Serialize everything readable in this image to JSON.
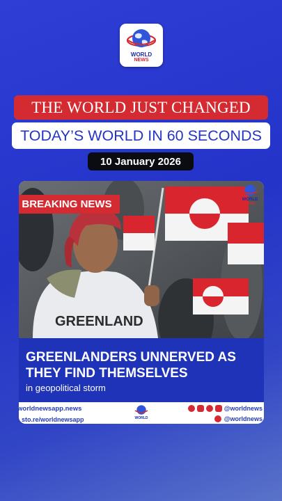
{
  "brand": {
    "logo_line1": "WORLD",
    "logo_line2": "NEWS",
    "colors": {
      "brand_blue": "#2433c8",
      "accent_red": "#d32b31"
    }
  },
  "banner_red": "THE WORLD JUST CHANGED",
  "banner_white": "TODAY’S WORLD IN 60 SECONDS",
  "date": "10 January 2026",
  "card": {
    "badge": "BREAKING NEWS",
    "shirt_text": "GREENLAND",
    "headline": "GREENLANDERS UNNERVED AS THEY FIND THEMSELVES",
    "subhead": "in geopolitical storm",
    "card_logo_line1": "WORLD",
    "card_logo_line2": "NEWS"
  },
  "footer": {
    "website": "worldnewsapp.news",
    "store_link": "sto.re/worldnewsapp",
    "handle_1": "@worldnews",
    "handle_2": "@worldnews",
    "logo_text": "WORLD",
    "icons": [
      "pinterest-icon",
      "youtube-icon",
      "snapchat-icon",
      "instagram-icon",
      "twitter-icon"
    ]
  }
}
